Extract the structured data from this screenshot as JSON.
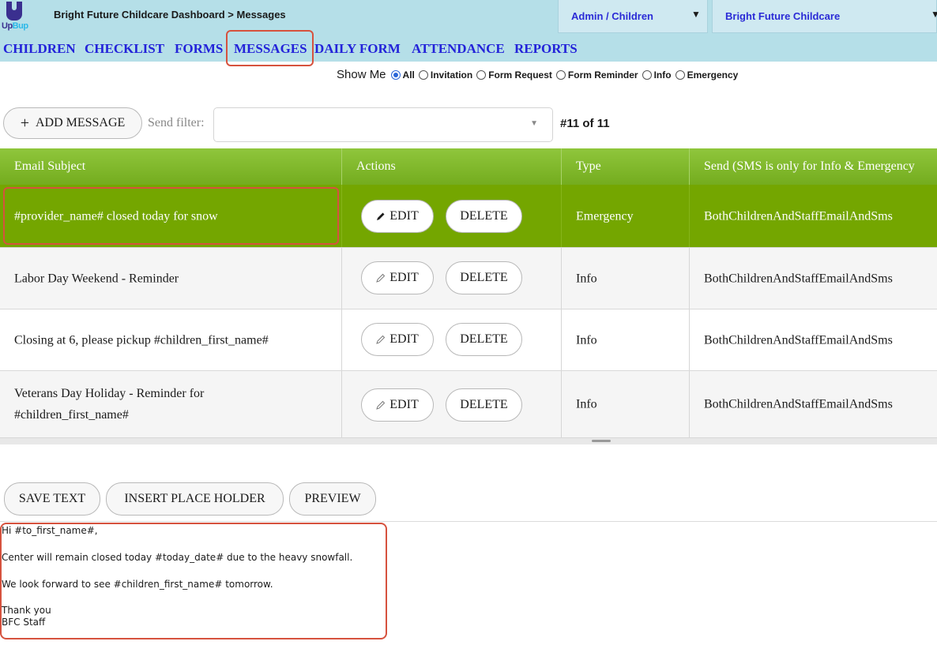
{
  "app": {
    "logo_text_up": "Up",
    "logo_text_bup": "Bup",
    "breadcrumb": "Bright Future Childcare Dashboard > Messages",
    "role_select": "Admin / Children",
    "center_select": "Bright Future Childcare",
    "caret": "▼"
  },
  "nav": {
    "items": [
      "CHILDREN",
      "CHECKLIST",
      "FORMS",
      "MESSAGES",
      "DAILY FORM",
      "ATTENDANCE",
      "REPORTS"
    ],
    "active": "MESSAGES"
  },
  "filters": {
    "show_me_label": "Show Me",
    "options": [
      "All",
      "Invitation",
      "Form Request",
      "Form Reminder",
      "Info",
      "Emergency"
    ],
    "selected": "All"
  },
  "toolbar": {
    "add_icon": "+",
    "add_label": "ADD MESSAGE",
    "send_filter_label": "Send filter:",
    "send_filter_value": "",
    "send_filter_caret": "▼",
    "count_label": "#11 of 11"
  },
  "table": {
    "headers": [
      "Email Subject",
      "Actions",
      "Type",
      "Send (SMS is only for Info & Emergency"
    ],
    "edit_label": "EDIT",
    "delete_label": "DELETE",
    "rows": [
      {
        "subject": "#provider_name# closed today for snow",
        "type": "Emergency",
        "send": "BothChildrenAndStaffEmailAndSms",
        "selected": true
      },
      {
        "subject": "Labor Day Weekend - Reminder",
        "type": "Info",
        "send": "BothChildrenAndStaffEmailAndSms",
        "selected": false
      },
      {
        "subject": "Closing at 6, please pickup #children_first_name#",
        "type": "Info",
        "send": "BothChildrenAndStaffEmailAndSms",
        "selected": false
      },
      {
        "subject_line1": "Veterans Day Holiday - Reminder for",
        "subject_line2": "#children_first_name#",
        "type": "Info",
        "send": "BothChildrenAndStaffEmailAndSms",
        "selected": false
      }
    ]
  },
  "editor": {
    "save_label": "SAVE TEXT",
    "placeholder_label": "INSERT PLACE HOLDER",
    "preview_label": "PREVIEW",
    "lines": [
      "Hi #to_first_name#,",
      "Center will remain closed today #today_date# due to the heavy snowfall.",
      "We look forward to see #children_first_name# tomorrow.",
      "Thank you",
      "BFC Staff"
    ]
  },
  "colors": {
    "header_bg": "#b5dfe8",
    "nav_link": "#2323d9",
    "table_header": "#8fc63c",
    "selected_row": "#74a600",
    "highlight_box": "#d6523e",
    "radio_accent": "#2a66d8"
  }
}
